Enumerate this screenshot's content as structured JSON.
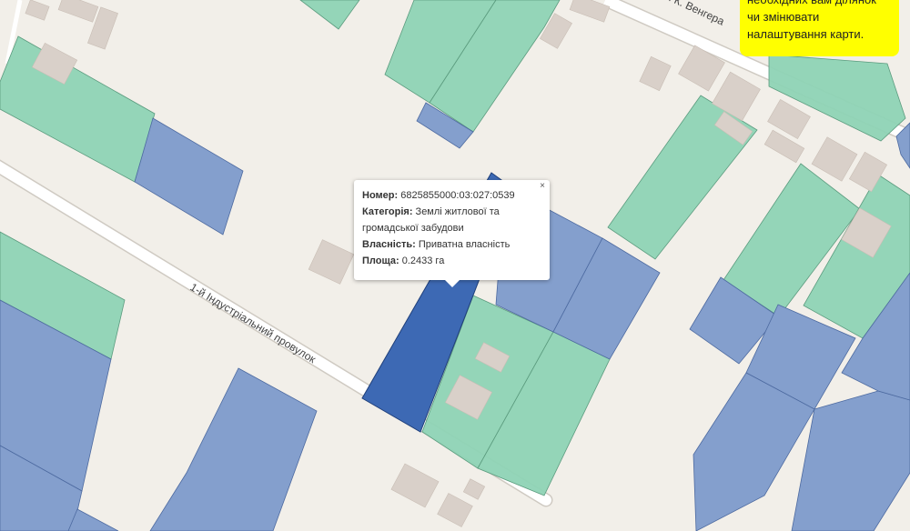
{
  "map": {
    "streets": [
      {
        "name": "1-й Індустріальний провулок"
      },
      {
        "name": "ая К. Венгера"
      }
    ]
  },
  "popup": {
    "close_label": "×",
    "number_label": "Номер:",
    "number_value": "6825855000:03:027:0539",
    "category_label": "Категорія:",
    "category_value_line1": "Землі житлової та",
    "category_value_line2": "громадської забудови",
    "ownership_label": "Власність:",
    "ownership_value": "Приватна власність",
    "area_label": "Площа:",
    "area_value": "0.2433 га"
  },
  "notice": {
    "lines": [
      "необхідних вам ділянок",
      "чи змінювати",
      "налаштування карти."
    ]
  },
  "colors": {
    "background": "#f2efe9",
    "residential_parcel": "#8ed3b5",
    "other_parcel": "#849fcd",
    "selected_parcel": "#3d69b4",
    "building": "#d9d0c9",
    "road": "#ffffff",
    "notice": "#ffff00"
  }
}
